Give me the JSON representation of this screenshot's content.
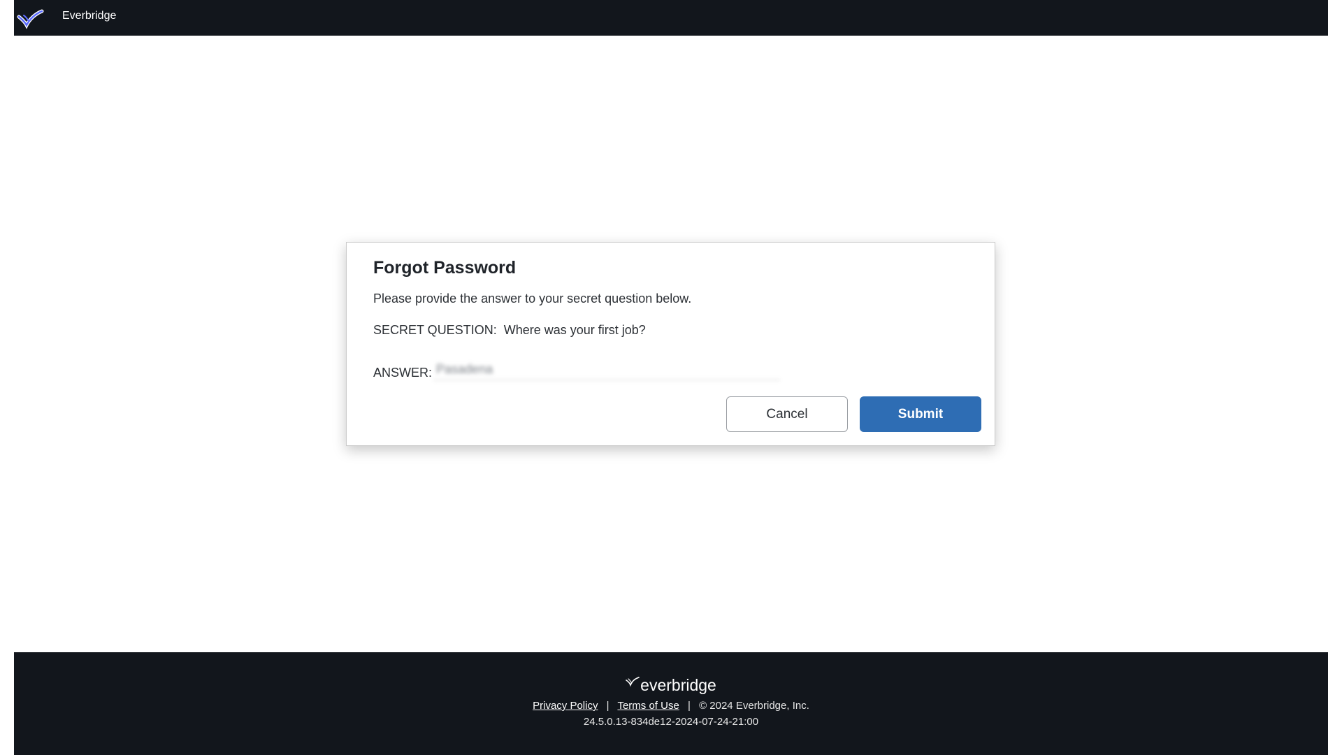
{
  "header": {
    "app_title": "Everbridge",
    "logo_icon": "everbridge-check-icon"
  },
  "dialog": {
    "title": "Forgot Password",
    "instructions": "Please provide the answer to your secret question below.",
    "question_label": "SECRET QUESTION:",
    "question_text": "Where was your first job?",
    "answer_label": "ANSWER:",
    "answer_value": "Pasadena",
    "cancel_label": "Cancel",
    "submit_label": "Submit"
  },
  "footer": {
    "brand": "everbridge",
    "privacy_label": "Privacy Policy",
    "terms_label": "Terms of Use",
    "separator": "|",
    "copyright": "©  2024 Everbridge, Inc.",
    "version": "24.5.0.13-834de12-2024-07-24-21:00"
  },
  "colors": {
    "bar_background": "#12161c",
    "submit_button": "#2e6db4",
    "logo_accent": "#5b6cff"
  }
}
